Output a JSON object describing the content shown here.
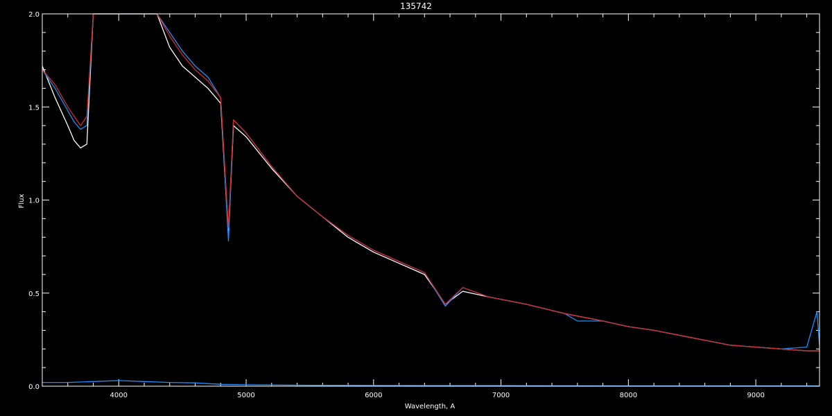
{
  "chart_data": {
    "type": "line",
    "title": "135742",
    "xlabel": "Wavelength, A",
    "ylabel": "Flux",
    "xlim": [
      3400,
      9500
    ],
    "ylim": [
      0.0,
      2.0
    ],
    "x_ticks": [
      4000,
      5000,
      6000,
      7000,
      8000,
      9000
    ],
    "x_tick_labels": [
      "4000",
      "5000",
      "6000",
      "7000",
      "8000",
      "9000"
    ],
    "y_ticks": [
      0.0,
      0.5,
      1.0,
      1.5,
      2.0
    ],
    "y_tick_labels": [
      "0.0",
      "0.5",
      "1.0",
      "1.5",
      "2.0"
    ],
    "grid": false,
    "legend": "none",
    "colors": {
      "background": "#000000",
      "axes": "#ffffff",
      "observed": "#ffffff",
      "observed_calibrated": "#1e90ff",
      "model": "#d42a2a",
      "error": "#1e90ff"
    },
    "series": [
      {
        "color_key": "observed",
        "x": [
          3400,
          3500,
          3600,
          3650,
          3700,
          3750,
          3800,
          3900,
          4000,
          4100,
          4200,
          4300,
          4400,
          4500,
          4600,
          4700,
          4800,
          4861,
          4900,
          5000,
          5200,
          5400,
          5600,
          5800,
          6000,
          6200,
          6400,
          6563,
          6700,
          6900,
          7200,
          7500,
          7800,
          8000,
          8200,
          8500,
          8800,
          9000,
          9200,
          9400,
          9500
        ],
        "y": [
          1.72,
          1.55,
          1.4,
          1.32,
          1.28,
          1.3,
          2.0,
          2.0,
          2.0,
          2.0,
          2.0,
          2.0,
          1.82,
          1.72,
          1.66,
          1.6,
          1.52,
          0.8,
          1.4,
          1.34,
          1.17,
          1.02,
          0.91,
          0.8,
          0.72,
          0.66,
          0.6,
          0.44,
          0.51,
          0.48,
          0.44,
          0.39,
          0.35,
          0.32,
          0.3,
          0.26,
          0.22,
          0.21,
          0.2,
          0.19,
          0.19
        ]
      },
      {
        "color_key": "observed_calibrated",
        "x": [
          3400,
          3500,
          3600,
          3650,
          3700,
          3750,
          3800,
          3900,
          4000,
          4100,
          4200,
          4300,
          4400,
          4500,
          4600,
          4700,
          4800,
          4861,
          4900,
          5000,
          5200,
          5400,
          5600,
          5800,
          6000,
          6200,
          6400,
          6563,
          6700,
          6900,
          7200,
          7500,
          7600,
          7800,
          8000,
          8200,
          8500,
          8800,
          9000,
          9200,
          9400,
          9480,
          9500
        ],
        "y": [
          1.7,
          1.6,
          1.48,
          1.42,
          1.38,
          1.4,
          2.0,
          2.0,
          2.0,
          2.0,
          2.0,
          2.0,
          1.9,
          1.8,
          1.72,
          1.66,
          1.55,
          0.78,
          1.43,
          1.36,
          1.18,
          1.02,
          0.91,
          0.81,
          0.73,
          0.67,
          0.61,
          0.43,
          0.53,
          0.48,
          0.44,
          0.39,
          0.35,
          0.35,
          0.32,
          0.3,
          0.26,
          0.22,
          0.21,
          0.2,
          0.21,
          0.4,
          0.22
        ]
      },
      {
        "color_key": "model",
        "x": [
          3400,
          3500,
          3600,
          3650,
          3700,
          3750,
          3800,
          3900,
          4000,
          4100,
          4200,
          4300,
          4400,
          4500,
          4600,
          4700,
          4800,
          4861,
          4900,
          5000,
          5200,
          5400,
          5600,
          5800,
          6000,
          6200,
          6400,
          6563,
          6700,
          6900,
          7200,
          7500,
          7800,
          8000,
          8200,
          8500,
          8800,
          9000,
          9200,
          9400,
          9500
        ],
        "y": [
          1.7,
          1.62,
          1.5,
          1.45,
          1.4,
          1.45,
          2.0,
          2.0,
          2.0,
          2.0,
          2.0,
          2.0,
          1.88,
          1.78,
          1.7,
          1.64,
          1.55,
          0.85,
          1.43,
          1.36,
          1.18,
          1.02,
          0.91,
          0.81,
          0.73,
          0.67,
          0.61,
          0.44,
          0.53,
          0.48,
          0.44,
          0.39,
          0.35,
          0.32,
          0.3,
          0.26,
          0.22,
          0.21,
          0.2,
          0.19,
          0.19
        ]
      },
      {
        "color_key": "error",
        "x": [
          3400,
          3600,
          3800,
          4000,
          4200,
          4400,
          4600,
          4800,
          5000,
          5500,
          6000,
          6500,
          7000,
          8000,
          9000,
          9500
        ],
        "y": [
          0.02,
          0.02,
          0.025,
          0.03,
          0.025,
          0.02,
          0.018,
          0.01,
          0.008,
          0.005,
          0.004,
          0.003,
          0.003,
          0.002,
          0.002,
          0.002
        ]
      }
    ]
  }
}
